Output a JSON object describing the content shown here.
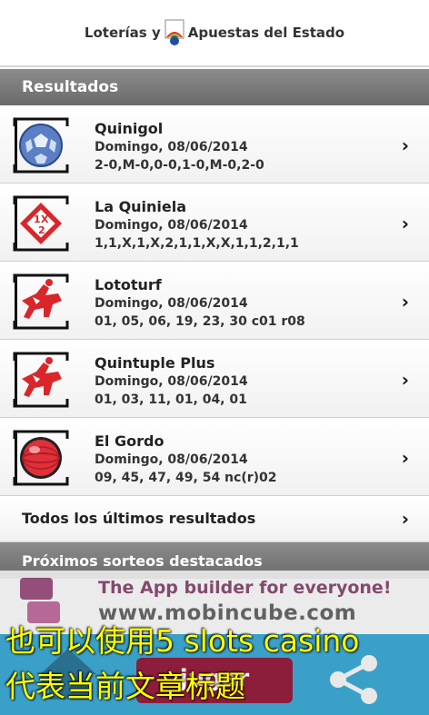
{
  "header": {
    "brand_left": "Loterías y",
    "brand_right": "Apuestas del Estado"
  },
  "results_section": {
    "title": "Resultados"
  },
  "results": [
    {
      "title": "Quinigol",
      "date": "Domingo, 08/06/2014",
      "numbers": "2-0,M-0,0-0,1-0,M-0,2-0",
      "icon": "soccer-ball-icon"
    },
    {
      "title": "La Quiniela",
      "date": "Domingo, 08/06/2014",
      "numbers": "1,1,X,1,X,2,1,1,X,X,1,1,2,1,1",
      "icon": "quiniela-1x2-icon"
    },
    {
      "title": "Lototurf",
      "date": "Domingo, 08/06/2014",
      "numbers": "01, 05, 06, 19, 23, 30 c01 r08",
      "icon": "horse-rider-icon"
    },
    {
      "title": "Quintuple Plus",
      "date": "Domingo, 08/06/2014",
      "numbers": "01, 03, 11, 01, 04, 01",
      "icon": "horse-rider-icon"
    },
    {
      "title": "El Gordo",
      "date": "Domingo, 08/06/2014",
      "numbers": "09, 45, 47, 49, 54 nc(r)02",
      "icon": "red-ball-icon"
    }
  ],
  "all_results": {
    "label": "Todos los últimos resultados"
  },
  "upcoming_section": {
    "title": "Próximos sorteos destacados"
  },
  "ad": {
    "line1": "The App builder for everyone!",
    "line2": "www.mobincube.com"
  },
  "bottom_bar": {
    "play_label": "jugar"
  },
  "overlay": {
    "line1": "也可以使用5 slots casino",
    "line2": "代表当前文章标题"
  },
  "colors": {
    "section_bar": "#7a7a7a",
    "bottom_bar": "#3aa0c8",
    "play_button": "#8d1e3b",
    "overlay_text": "#ffff00"
  }
}
